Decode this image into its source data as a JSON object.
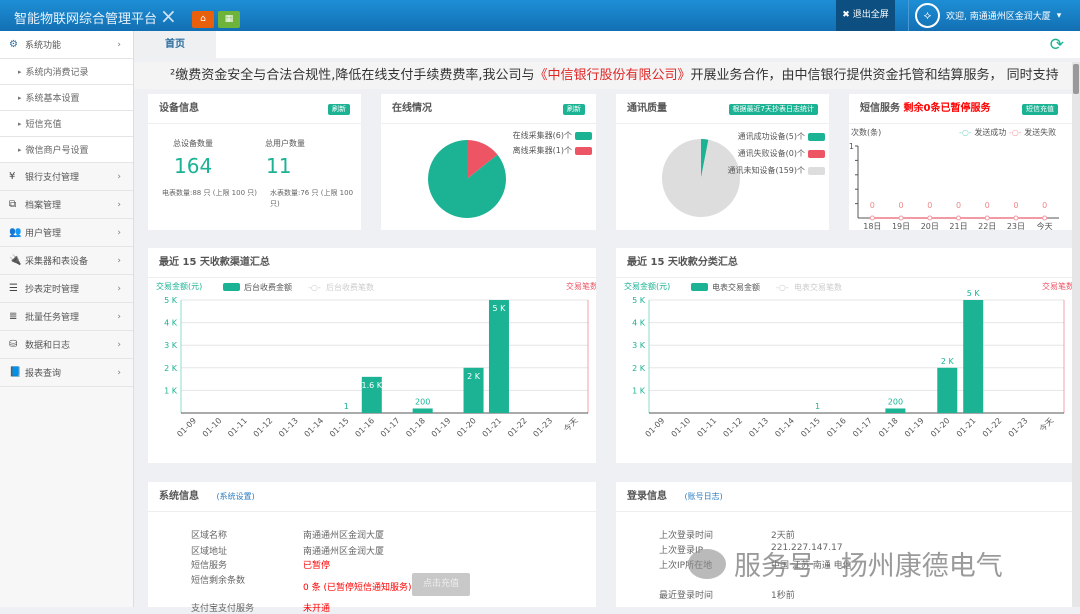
{
  "header": {
    "title": "智能物联网综合管理平台",
    "close_icon": "×",
    "home_icon": "home-icon",
    "grid_icon": "grid-icon",
    "fullscreen_label": "退出全屏",
    "welcome": "欢迎, 南通通州区金润大厦"
  },
  "sidebar": {
    "items": [
      {
        "label": "系统功能",
        "icon": "gears-icon",
        "expanded": true,
        "children": [
          "系统内消费记录",
          "系统基本设置",
          "短信充值",
          "微信商户号设置"
        ]
      },
      {
        "label": "银行支付管理",
        "icon": "¥"
      },
      {
        "label": "档案管理",
        "icon": "copy-icon"
      },
      {
        "label": "用户管理",
        "icon": "users-icon"
      },
      {
        "label": "采集器和表设备",
        "icon": "plug-icon"
      },
      {
        "label": "抄表定时管理",
        "icon": "tasks-icon"
      },
      {
        "label": "批量任务管理",
        "icon": "list-icon"
      },
      {
        "label": "数据和日志",
        "icon": "database-icon"
      },
      {
        "label": "报表查询",
        "icon": "book-icon"
      }
    ]
  },
  "tabs": [
    {
      "label": "首页"
    }
  ],
  "marquee": {
    "before": "²缴费资金安全与合法合规性,降低在线支付手续费费率,我公司与",
    "highlight": "《中信银行股份有限公司》",
    "after": "开展业务合作，由中信银行提供资金托管和结算服务， 同时支持"
  },
  "device_info": {
    "title": "设备信息",
    "badge": "刷新",
    "total_devices_label": "总设备数量",
    "total_devices": "164",
    "total_users_label": "总用户数量",
    "total_users": "11",
    "electric_meters": "电表数量:88 只 (上限 100 只)",
    "water_meters": "水表数量:76 只 (上限 100 只)"
  },
  "online": {
    "title": "在线情况",
    "badge": "刷新",
    "legend": [
      "在线采集器(6)个",
      "离线采集器(1)个"
    ],
    "values": [
      6,
      1
    ],
    "colors": [
      "#1bb394",
      "#ed5565"
    ]
  },
  "comm": {
    "title": "通讯质量",
    "badge": "根据最近7天抄表日志统计",
    "legend": [
      "通讯成功设备(5)个",
      "通讯失败设备(0)个",
      "通讯未知设备(159)个"
    ],
    "values": [
      5,
      0,
      159
    ],
    "colors": [
      "#1bb394",
      "#ed5565",
      "#dddddd"
    ]
  },
  "sms": {
    "title": "短信服务",
    "alert": "剩余0条已暂停服务",
    "badge": "短信充值",
    "ylabel": "次数(条)",
    "legend": [
      "发送成功",
      "发送失败"
    ],
    "ymax": "1",
    "x": [
      "18日",
      "19日",
      "20日",
      "21日",
      "22日",
      "23日",
      "今天"
    ],
    "values": [
      0,
      0,
      0,
      0,
      0,
      0,
      0
    ]
  },
  "chart_data": [
    {
      "type": "bar",
      "title": "最近 15 天收款渠道汇总",
      "ylabel": "交易金额(元)",
      "y2label": "交易笔数",
      "legend": [
        "后台收费金额",
        "后台收费笔数"
      ],
      "ylim": [
        0,
        5000
      ],
      "yticks": [
        "1 K",
        "2 K",
        "3 K",
        "4 K",
        "5 K"
      ],
      "categories": [
        "01-09",
        "01-10",
        "01-11",
        "01-12",
        "01-13",
        "01-14",
        "01-15",
        "01-16",
        "01-17",
        "01-18",
        "01-19",
        "01-20",
        "01-21",
        "01-22",
        "01-23",
        "今天"
      ],
      "values": [
        0,
        0,
        0,
        0,
        0,
        0,
        1,
        1600,
        0,
        200,
        0,
        2000,
        5000,
        0,
        0,
        0
      ],
      "labels": [
        "",
        "",
        "",
        "",
        "",
        "",
        "1",
        "1.6 K",
        "",
        "200",
        "",
        "2 K",
        "5 K",
        "",
        "",
        ""
      ],
      "label_inside": true
    },
    {
      "type": "bar",
      "title": "最近 15 天收款分类汇总",
      "ylabel": "交易金额(元)",
      "y2label": "交易笔数",
      "legend": [
        "电表交易金额",
        "电表交易笔数"
      ],
      "ylim": [
        0,
        5000
      ],
      "yticks": [
        "1 K",
        "2 K",
        "3 K",
        "4 K",
        "5 K"
      ],
      "categories": [
        "01-09",
        "01-10",
        "01-11",
        "01-12",
        "01-13",
        "01-14",
        "01-15",
        "01-16",
        "01-17",
        "01-18",
        "01-19",
        "01-20",
        "01-21",
        "01-22",
        "01-23",
        "今天"
      ],
      "values": [
        0,
        0,
        0,
        0,
        0,
        0,
        1,
        0,
        0,
        200,
        0,
        2000,
        5000,
        0,
        0,
        0
      ],
      "labels": [
        "",
        "",
        "",
        "",
        "",
        "",
        "1",
        "",
        "",
        "200",
        "",
        "2 K",
        "5 K",
        "",
        "",
        ""
      ],
      "label_inside": false
    }
  ],
  "system_info": {
    "title": "系统信息",
    "link": "(系统设置)",
    "rows": [
      {
        "k": "区域名称",
        "v": "南通通州区金润大厦"
      },
      {
        "k": "区域地址",
        "v": "南通通州区金润大厦"
      },
      {
        "k": "短信服务",
        "v": "已暂停"
      },
      {
        "k": "短信剩余条数",
        "v": "0 条 (已暂停短信通知服务)"
      },
      {
        "k": "支付宝支付服务",
        "v": "未开通"
      }
    ],
    "recharge_button": "点击充值"
  },
  "login_info": {
    "title": "登录信息",
    "link": "(账号日志)",
    "rows": [
      {
        "k": "上次登录时间",
        "v": "2天前"
      },
      {
        "k": "上次登录IP",
        "v": "221.227.147.17"
      },
      {
        "k": "上次IP所在地",
        "v": "中国 江苏 南通 电信"
      },
      {
        "k": "最近登录时间",
        "v": "1秒前"
      }
    ]
  },
  "watermark": "服务号 · 扬州康德电气",
  "colors": {
    "accent": "#1bb394",
    "danger": "#ed5565",
    "header": "#1a7fc1"
  }
}
